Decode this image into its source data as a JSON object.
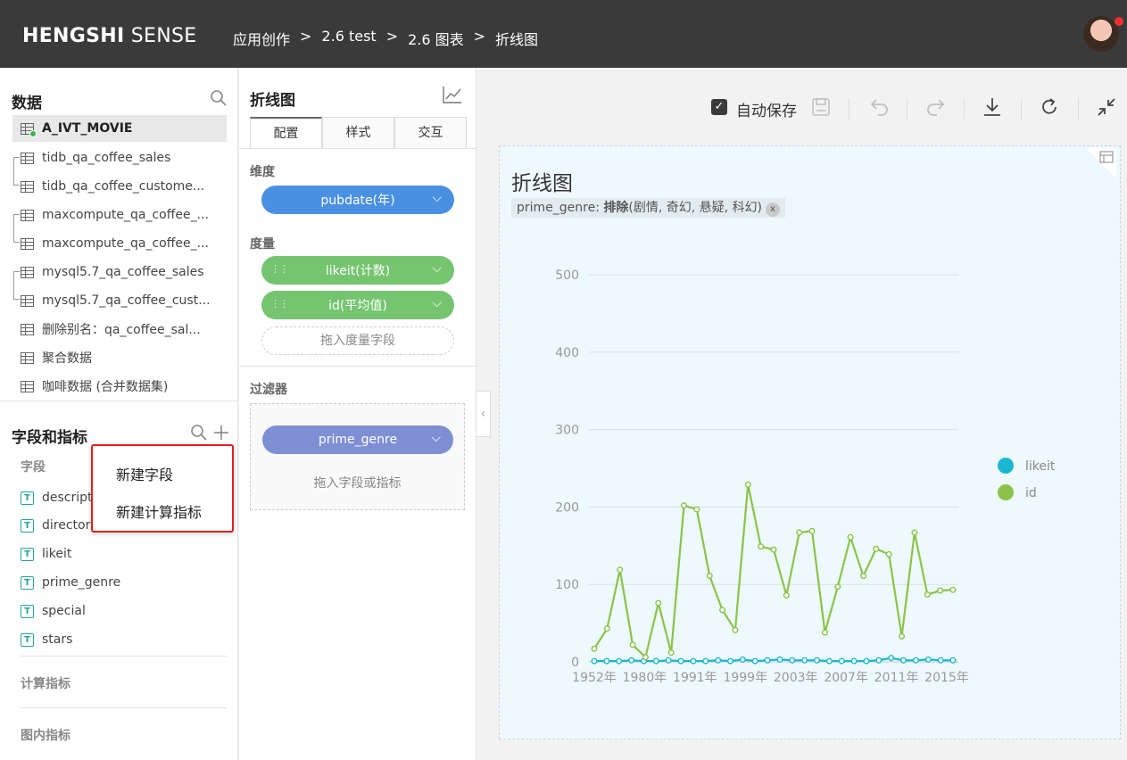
{
  "header": {
    "logo_bold": "HENGSHI",
    "logo_light": "SENSE",
    "breadcrumb": [
      "应用创作",
      "2.6 test",
      "2.6 图表",
      "折线图"
    ],
    "separator": ">"
  },
  "data_panel": {
    "title": "数据",
    "datasets": [
      "A_IVT_MOVIE",
      "tidb_qa_coffee_sales",
      "tidb_qa_coffee_custome...",
      "maxcompute_qa_coffee_...",
      "maxcompute_qa_coffee_...",
      "mysql5.7_qa_coffee_sales",
      "mysql5.7_qa_coffee_cust...",
      "删除别名：qa_coffee_sal...",
      "聚合数据",
      "咖啡数据 (合并数据集)"
    ]
  },
  "fields_panel": {
    "title": "字段和指标",
    "fields_label": "字段",
    "fields": [
      "descripti",
      "director",
      "likeit",
      "prime_genre",
      "special",
      "stars"
    ],
    "calc_label": "计算指标",
    "chart_metric_label": "图内指标"
  },
  "popup_menu": {
    "items": [
      "新建字段",
      "新建计算指标"
    ]
  },
  "config_panel": {
    "title": "折线图",
    "tabs": [
      "配置",
      "样式",
      "交互"
    ],
    "dimension_label": "维度",
    "dimension": "pubdate(年)",
    "measure_label": "度量",
    "measures": [
      "likeit(计数)",
      "id(平均值)"
    ],
    "measure_drop": "拖入度量字段",
    "filter_label": "过滤器",
    "filter": "prime_genre",
    "filter_drop": "拖入字段或指标"
  },
  "toolbar": {
    "autosave_label": "自动保存",
    "autosave_checked": true,
    "checkmark": "✓"
  },
  "chart": {
    "title": "折线图",
    "filter_tag_field": "prime_genre:",
    "filter_tag_op": "排除",
    "filter_tag_values": "(剧情, 奇幻, 悬疑, 科幻)",
    "filter_tag_close": "x"
  },
  "colors": {
    "likeit": "#1ab8d0",
    "id": "#8bc34a",
    "dimension_pill": "#4a90e2",
    "measure_pill": "#75c470",
    "filter_pill": "#7e8fd4"
  },
  "chart_data": {
    "type": "line",
    "title": "折线图",
    "xlabel": "",
    "ylabel": "",
    "ylim": [
      0,
      500
    ],
    "y_ticks": [
      0,
      100,
      200,
      300,
      400,
      500
    ],
    "x_ticks": [
      "1952年",
      "1980年",
      "1991年",
      "1999年",
      "2003年",
      "2007年",
      "2011年",
      "2015年"
    ],
    "legend_position": "right",
    "grid": true,
    "series": [
      {
        "name": "likeit",
        "color": "#1ab8d0",
        "values": [
          1,
          1,
          1,
          2,
          1,
          1,
          2,
          1,
          1,
          1,
          2,
          1,
          3,
          1,
          2,
          3,
          2,
          2,
          2,
          1,
          1,
          1,
          1,
          2,
          5,
          2,
          2,
          3,
          2,
          2
        ]
      },
      {
        "name": "id",
        "color": "#8bc34a",
        "values": [
          17,
          43,
          119,
          22,
          6,
          76,
          12,
          202,
          197,
          111,
          67,
          41,
          229,
          149,
          145,
          86,
          167,
          169,
          38,
          97,
          161,
          111,
          146,
          139,
          33,
          167,
          87,
          92,
          93
        ]
      }
    ]
  }
}
